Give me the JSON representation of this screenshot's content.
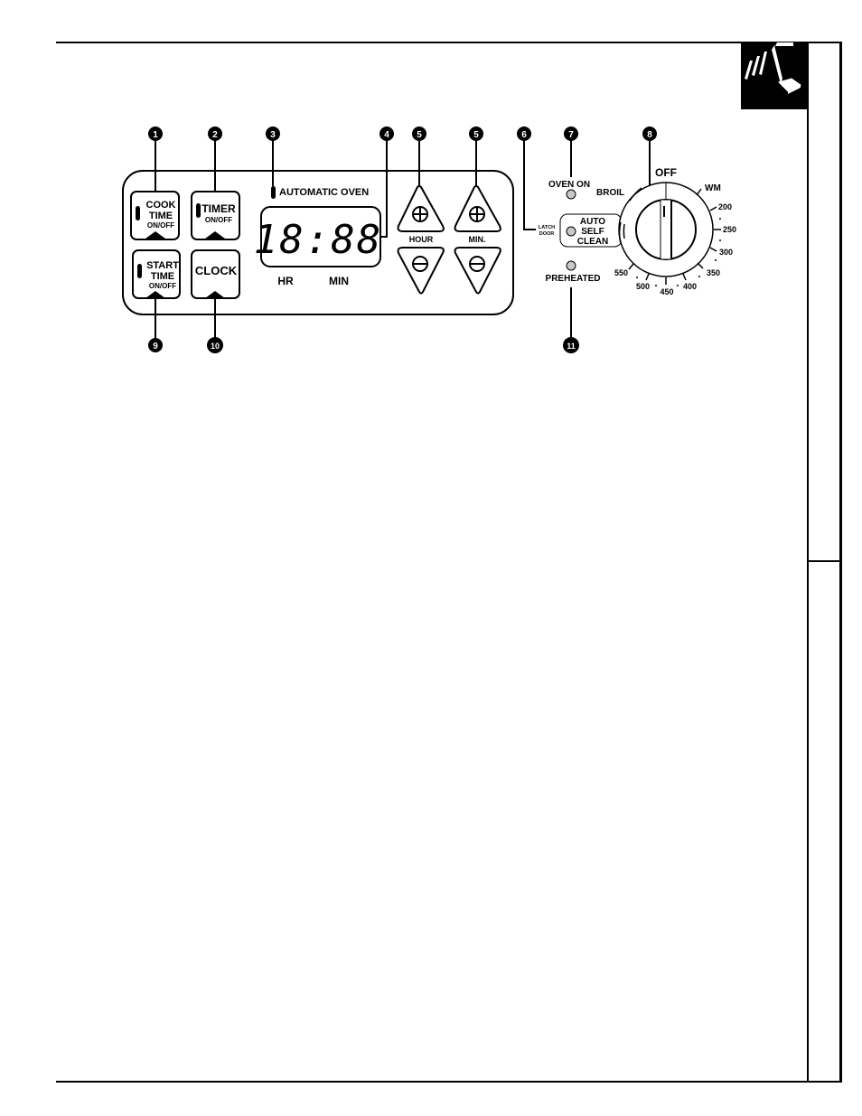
{
  "panel": {
    "callouts": [
      "1",
      "2",
      "3",
      "4",
      "5",
      "5",
      "6",
      "7",
      "8",
      "9",
      "10",
      "11"
    ],
    "buttons": {
      "cook_time": {
        "line1": "COOK",
        "line2": "TIME",
        "line3": "ON/OFF"
      },
      "timer": {
        "line1": "TIMER",
        "line2": "ON/OFF"
      },
      "start_time": {
        "line1": "START",
        "line2": "TIME",
        "line3": "ON/OFF"
      },
      "clock": {
        "line1": "CLOCK"
      }
    },
    "indicator_label": "AUTOMATIC OVEN",
    "display": {
      "value": "18:88",
      "hr_label": "HR",
      "min_label": "MIN"
    },
    "arrows": {
      "hour_label": "HOUR",
      "min_label": "MIN.",
      "plus_icon": "⊕",
      "minus_icon": "⊖"
    },
    "lights": {
      "oven_on": "OVEN ON",
      "latch_line1": "LATCH",
      "latch_line2": "DOOR",
      "auto_line1": "AUTO",
      "auto_line2": "SELF",
      "auto_line3": "CLEAN",
      "preheated": "PREHEATED"
    },
    "dial": {
      "labels": {
        "off": "OFF",
        "broil": "BROIL",
        "wm": "WM",
        "t200": "200",
        "t250": "250",
        "t300": "300",
        "t350": "350",
        "t400": "400",
        "t450": "450",
        "t500": "500",
        "t550": "550"
      }
    }
  },
  "colors": {
    "ink": "#000000",
    "indicator_light": "#c8c8c8",
    "paper": "#ffffff"
  }
}
